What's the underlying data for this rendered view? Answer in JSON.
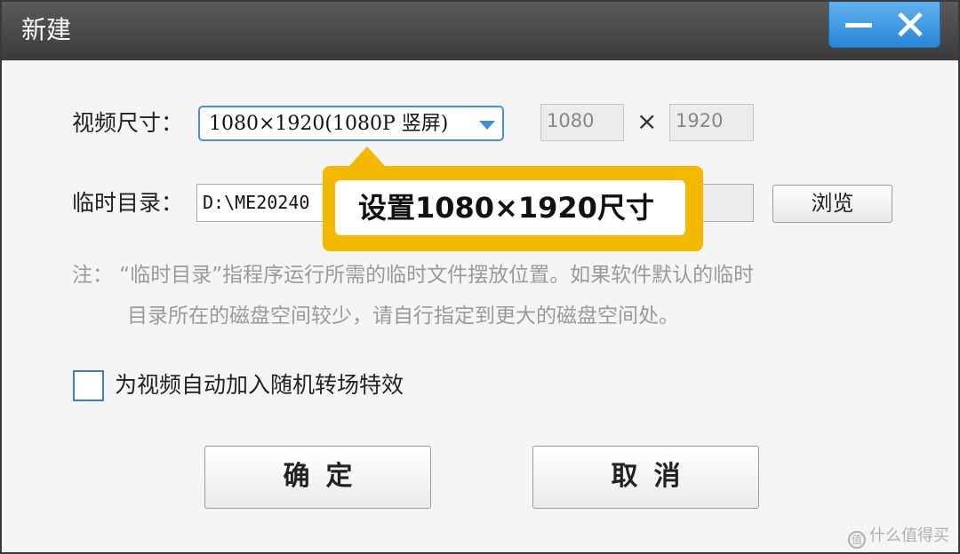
{
  "window": {
    "title": "新建"
  },
  "video_size": {
    "label": "视频尺寸：",
    "selected": "1080×1920(1080P 竖屏)",
    "width": "1080",
    "separator": "×",
    "height": "1920"
  },
  "temp_dir": {
    "label": "临时目录：",
    "value": "D:\\ME20240",
    "browse_label": "浏览"
  },
  "note": {
    "line1": "注：  “临时目录”指程序运行所需的临时文件摆放位置。如果软件默认的临时",
    "line2": "目录所在的磁盘空间较少，请自行指定到更大的磁盘空间处。"
  },
  "checkbox": {
    "label": "为视频自动加入随机转场特效",
    "checked": false
  },
  "buttons": {
    "ok": "确定",
    "cancel": "取消"
  },
  "callout": {
    "text": "设置1080×1920尺寸",
    "color": "#f5b800"
  },
  "watermark": {
    "text": "什么值得买",
    "icon": "值"
  },
  "colors": {
    "accent": "#3a8fd6",
    "titlebar": "#4a4a4a"
  }
}
